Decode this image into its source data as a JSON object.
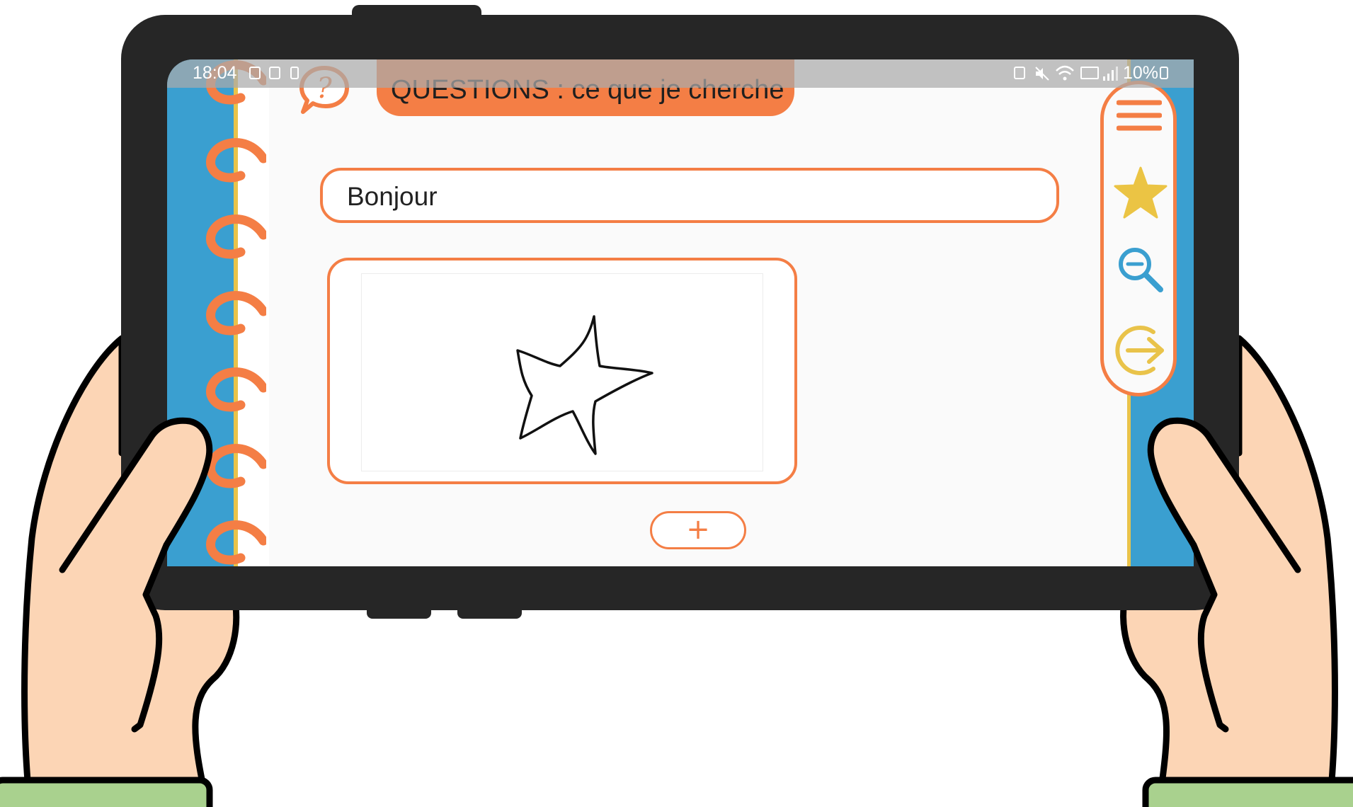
{
  "status_bar": {
    "time": "18:04",
    "battery_percent": "10%"
  },
  "header": {
    "title": "QUESTIONS : ce que je cherche",
    "help_icon": "question-bubble-icon"
  },
  "question_input": {
    "value": "Bonjour"
  },
  "drawing": {
    "content_icon": "hand-drawn-star"
  },
  "add_button": {
    "label": "+"
  },
  "toolbar": {
    "items": [
      "menu-icon",
      "star-icon",
      "zoom-out-icon",
      "exit-arrow-icon"
    ]
  },
  "colors": {
    "accent_orange": "#f47e45",
    "screen_blue": "#3a9fd0",
    "star_yellow": "#ebc444",
    "zoom_blue": "#3a9fd0",
    "exit_yellow": "#e9c34a",
    "skin": "#fcd5b5",
    "sleeve": "#a9d18e",
    "device": "#262626"
  }
}
